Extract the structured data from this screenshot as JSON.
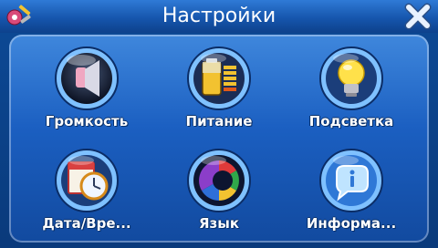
{
  "window": {
    "title": "Настройки"
  },
  "icons": {
    "app": "tools-icon",
    "close": "close-icon"
  },
  "tiles": [
    {
      "label": "Громкость",
      "icon": "speaker-icon"
    },
    {
      "label": "Питание",
      "icon": "battery-icon"
    },
    {
      "label": "Подсветка",
      "icon": "lightbulb-icon"
    },
    {
      "label": "Дата/Вре...",
      "icon": "calendar-clock-icon"
    },
    {
      "label": "Язык",
      "icon": "language-icon"
    },
    {
      "label": "Информа...",
      "icon": "info-icon"
    }
  ]
}
